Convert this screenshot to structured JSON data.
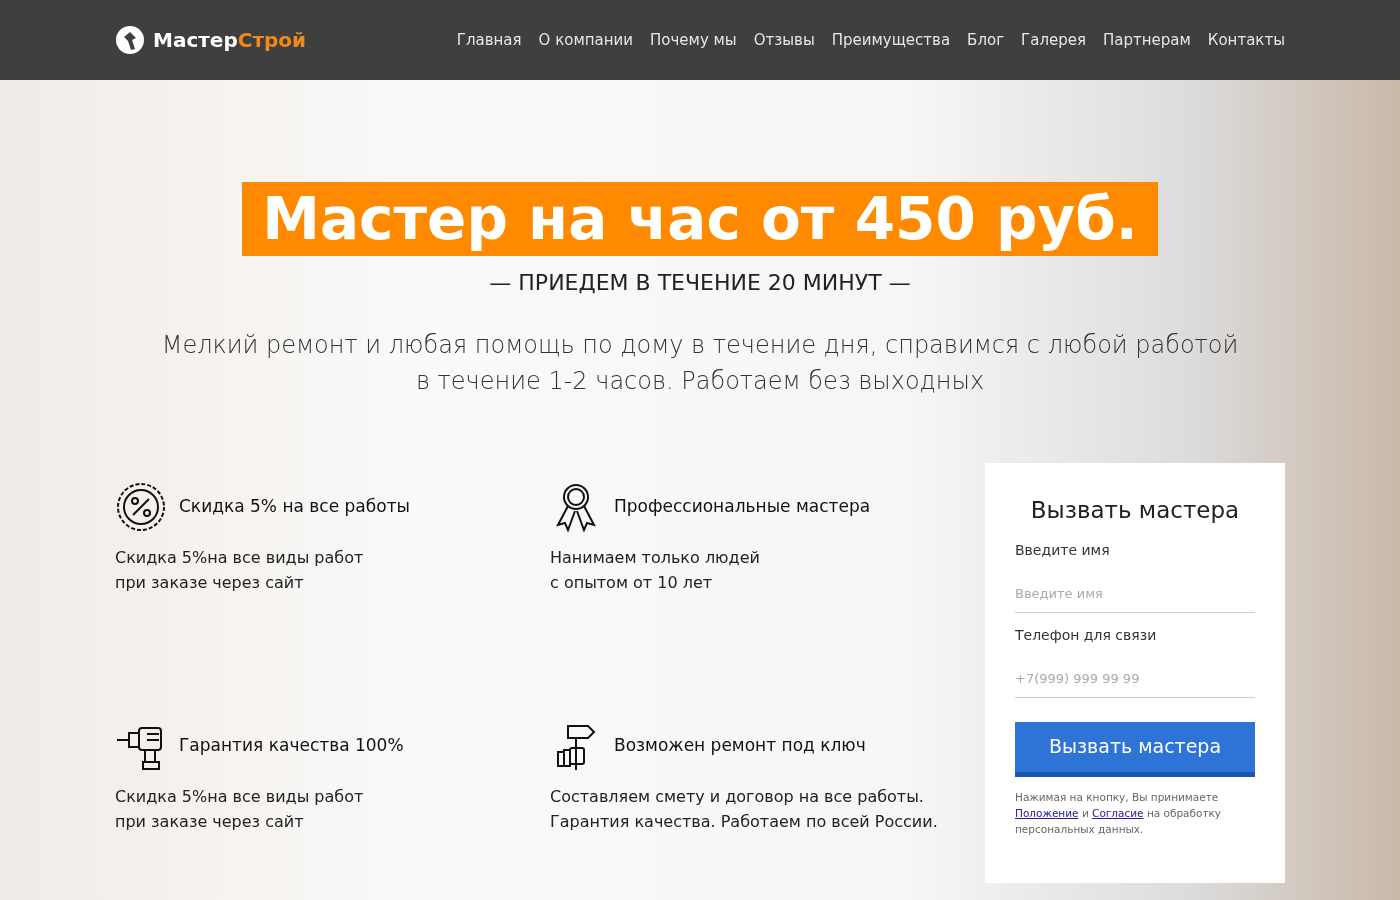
{
  "header": {
    "logo": {
      "part1": "Мастер",
      "part2": "Строй"
    },
    "nav": [
      {
        "label": "Главная"
      },
      {
        "label": "О компании"
      },
      {
        "label": "Почему мы"
      },
      {
        "label": "Отзывы"
      },
      {
        "label": "Преимущества"
      },
      {
        "label": "Блог"
      },
      {
        "label": "Галерея"
      },
      {
        "label": "Партнерам"
      },
      {
        "label": "Контакты"
      }
    ]
  },
  "hero": {
    "title": "Мастер на час от 450 руб.",
    "subtitle": "— ПРИЕДЕМ В ТЕЧЕНИЕ 20 МИНУТ —",
    "description": "Мелкий ремонт и любая помощь по дому в течение дня, справимся с любой работой в течение 1-2 часов. Работаем без выходных"
  },
  "features": [
    {
      "kind": "discount",
      "title": "Скидка 5%  на все работы",
      "lines": [
        "Скидка 5%на все виды работ",
        "при заказе через сайт"
      ]
    },
    {
      "kind": "medal",
      "title": "Профессиональные мастера",
      "lines": [
        "Нанимаем только людей",
        "с опытом от 10 лет"
      ]
    },
    {
      "kind": "drill",
      "title": "Гарантия качества 100%",
      "lines": [
        "Скидка 5%на все виды работ",
        "при заказе через сайт"
      ]
    },
    {
      "kind": "tools",
      "title": "Возможен ремонт под ключ",
      "lines": [
        "Составляем смету и договор на все работы.",
        "Гарантия качества. Работаем по всей России."
      ]
    }
  ],
  "form": {
    "title": "Вызвать мастера",
    "fields": [
      {
        "label": "Введите имя",
        "placeholder": "Введите имя"
      },
      {
        "label": "Телефон для связи",
        "placeholder": "+7(999) 999 99 99"
      }
    ],
    "button": "Вызвать мастера",
    "consent": {
      "before": "Нажимая на кнопку, Вы принимаете",
      "link1": "Положение",
      "middle": "и",
      "link2": "Согласие",
      "after": "на обработку персональных данных."
    }
  }
}
